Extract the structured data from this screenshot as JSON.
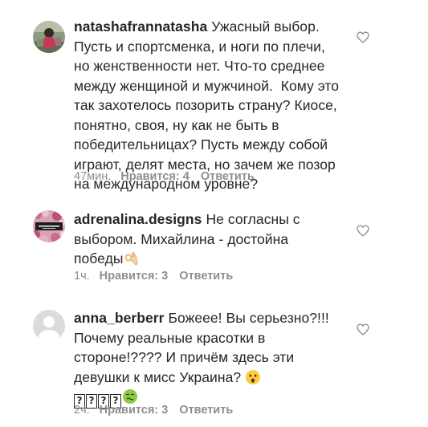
{
  "comments": [
    {
      "username": "natashafrannatasha",
      "text": "Ужасный выбор. Пусть и спортсменка, и ноги по плечи, но женственности нет. Что-то среднее между женщиной и мужчиной.  Кому это так захотелось позорить страну? Киосе, понятно, своя, ну как не быть в победительницах? Пусть между собой играют, делят места, но зачем же позор на международном уровне?",
      "time": "47мин.",
      "likes": "Нравится: 4",
      "reply": "Ответить",
      "avatar_icon": "user-avatar-photo",
      "like_icon": "heart-outline-icon"
    },
    {
      "username": "adrenalina.designs",
      "text": "Не согласны с выбором. Михайлина - достойна победы",
      "emoji": "ok-hand-emoji",
      "time": "1ч.",
      "likes": "Нравится: 3",
      "reply": "Ответить",
      "avatar_icon": "brand-logo-avatar",
      "like_icon": "heart-outline-icon"
    },
    {
      "username": "anna_berberr",
      "text": "Божеее! Вы серьезно?!!! Почему реальные красотки в стороне!???? И причём здесь эти девушки к мисс Украина?",
      "emoji": "astonished-face-emoji",
      "broken_glyphs": [
        "?",
        "?",
        "?",
        "?"
      ],
      "emoji_end": "nauseated-face-emoji",
      "time": "2ч.",
      "likes": "Нравится: 3",
      "reply": "Ответить",
      "avatar_icon": "default-avatar-icon",
      "like_icon": "heart-outline-icon"
    }
  ],
  "colors": {
    "text": "#262626",
    "meta": "#8e8e8e",
    "heart": "#8e8e8e",
    "default_avatar_bg": "#dbdbdb"
  }
}
